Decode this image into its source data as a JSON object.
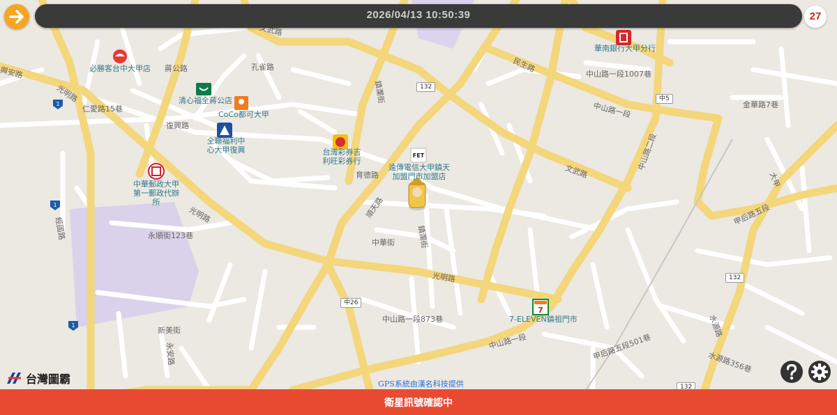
{
  "header": {
    "timestamp": "2026/04/13 10:50:39",
    "counter": "27"
  },
  "footer": {
    "status": "衛星訊號確認中",
    "gps_credit": "GPS系統由漢名科技提供"
  },
  "logo": {
    "text": "台灣圖霸"
  },
  "colors": {
    "major_road": "#f4d67b",
    "minor_road": "#ffffff",
    "background": "#ece8e2",
    "park": "#d9d2ea",
    "status_bar": "#e84a32",
    "accent": "#f5a623"
  },
  "pois": [
    {
      "name": "必勝客台中大甲店",
      "icon": "pizza-hut-icon"
    },
    {
      "name": "清心福全蔣公店",
      "icon": "chingshin-icon"
    },
    {
      "name": "CoCo都可大甲",
      "icon": "coco-icon"
    },
    {
      "name": "全聯福利中心大甲復興",
      "icon": "pxmart-icon"
    },
    {
      "name": "中華郵政大甲第一郵政代辦所",
      "icon": "post-office-icon"
    },
    {
      "name": "台灣彩券吉利旺彩券行",
      "icon": "lottery-icon"
    },
    {
      "name": "遠傳電信大甲鎮天加盟門市加盟店",
      "icon": "fet-icon"
    },
    {
      "name": "華南銀行大甲分行",
      "icon": "bank-icon"
    },
    {
      "name": "7-ELEVEN鎮祖門市",
      "icon": "seven-eleven-icon"
    }
  ],
  "streets": [
    "文武路",
    "民生路",
    "中山路一段1007巷",
    "光明路",
    "孔雀路",
    "蔣公路",
    "鎮瀾街",
    "中山路一段",
    "育德路",
    "順天路",
    "中華街",
    "文武路",
    "復興路",
    "經國路",
    "甲后路五段",
    "水源路",
    "中山路一段873巷",
    "中山路一段",
    "新美街",
    "永安路",
    "永順街123巷",
    "甲后路五段501巷",
    "水源路356巷",
    "金華路7巷",
    "大甲",
    "仁愛路15巷",
    "光明路",
    "鎮瀾街",
    "中山路二段",
    "光明路",
    "興安路"
  ],
  "road_badges": [
    "132",
    "中5",
    "132",
    "132",
    "中26",
    "132"
  ],
  "highway_markers": [
    "1",
    "1",
    "1"
  ],
  "user_marker": {
    "icon": "deity-avatar-icon"
  }
}
